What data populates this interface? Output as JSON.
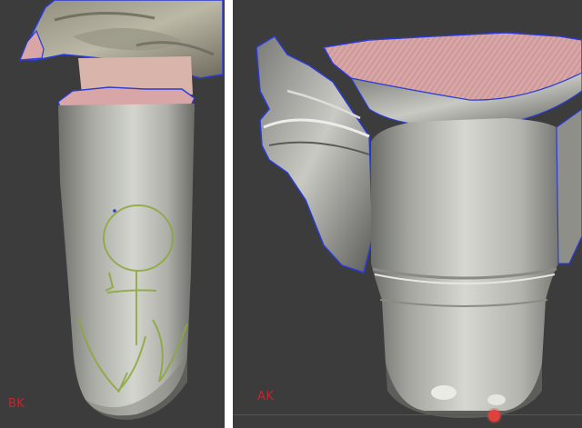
{
  "views": [
    {
      "label": "BK",
      "label_color": "#c2262e"
    },
    {
      "label": "AK",
      "label_color": "#c2262e"
    }
  ],
  "colors": {
    "background": "#3c3c3c",
    "divider": "#ffffff",
    "mesh_surface": "#c8c9c2",
    "cut_surface": "#d8a6a6",
    "boundary_edge": "#2a3bd8",
    "marker": "#8ba83a",
    "handle": "#e0413c",
    "timeline": "#555555"
  },
  "icons": {
    "selection_handle": "red-dot-handle-icon"
  }
}
